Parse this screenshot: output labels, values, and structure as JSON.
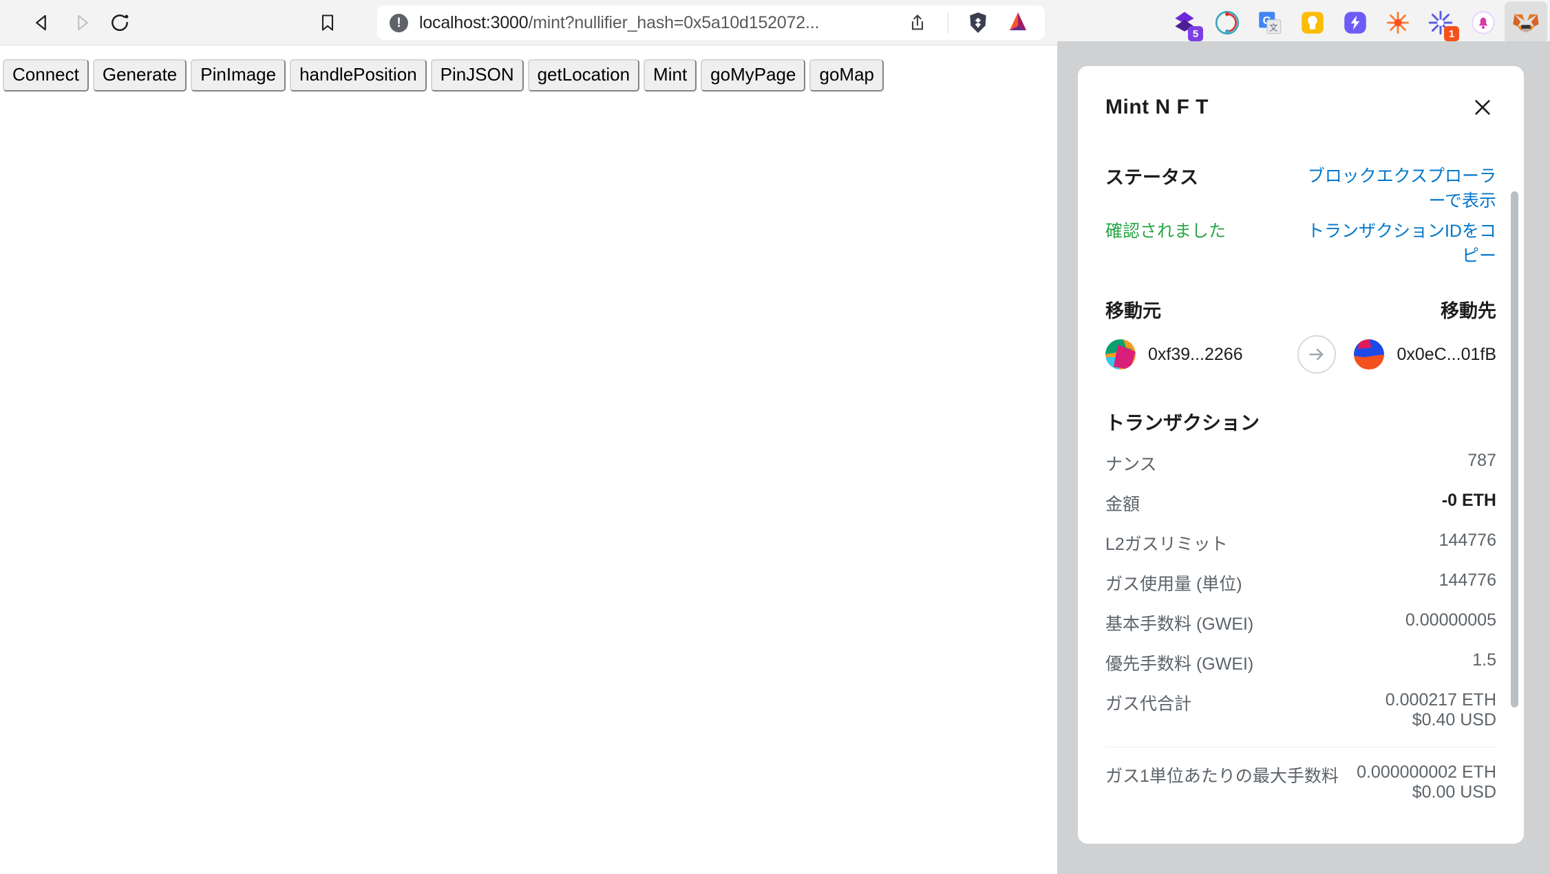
{
  "browser": {
    "back_label": "Back",
    "forward_label": "Forward",
    "reload_label": "Reload",
    "bookmark_label": "Bookmark",
    "url_host": "localhost:3000",
    "url_path": "/mint?nullifier_hash=0x5a10d152072...",
    "url_full": "localhost:3000/mint?nullifier_hash=0x5a10d152072...",
    "security_icon": "not-secure-icon",
    "share_label": "Share",
    "shields_label": "Brave Shields",
    "rewards_label": "Brave Rewards",
    "extensions": [
      {
        "name": "ethereum-wallet-extension",
        "badge": "5",
        "badge_color": "#8247e5"
      },
      {
        "name": "sync-extension",
        "badge": "",
        "badge_color": ""
      },
      {
        "name": "google-translate-extension",
        "badge": "",
        "badge_color": ""
      },
      {
        "name": "notion-web-clipper-extension",
        "badge": "",
        "badge_color": ""
      },
      {
        "name": "lightning-extension",
        "badge": "",
        "badge_color": ""
      },
      {
        "name": "starburst-extension",
        "badge": "",
        "badge_color": ""
      },
      {
        "name": "snowflake-extension",
        "badge": "1",
        "badge_color": "#f6511d"
      },
      {
        "name": "notifications-bell-extension",
        "badge": "",
        "badge_color": ""
      },
      {
        "name": "metamask-extension",
        "badge": "",
        "badge_color": ""
      }
    ]
  },
  "page": {
    "buttons": [
      "Connect",
      "Generate",
      "PinImage",
      "handlePosition",
      "PinJSON",
      "getLocation",
      "Mint",
      "goMyPage",
      "goMap"
    ]
  },
  "metamask": {
    "title": "Mint N F T",
    "close_label": "閉じる",
    "status": {
      "label": "ステータス",
      "value": "確認されました",
      "value_color": "#28a745",
      "view_explorer_link": "ブロックエクスプローラーで表示",
      "copy_txid_link": "トランザクションIDをコピー",
      "link_color": "#0376c9"
    },
    "transfer": {
      "from_label": "移動元",
      "to_label": "移動先",
      "from_address": "0xf39...2266",
      "to_address": "0x0eC...01fB",
      "arrow_icon": "arrow-right-icon"
    },
    "transaction": {
      "heading": "トランザクション",
      "rows": [
        {
          "label": "ナンス",
          "value": "787",
          "sub": "",
          "strong": false
        },
        {
          "label": "金額",
          "value": "-0 ETH",
          "sub": "",
          "strong": true
        },
        {
          "label": "L2ガスリミット",
          "value": "144776",
          "sub": "",
          "strong": false
        },
        {
          "label": "ガス使用量 (単位)",
          "value": "144776",
          "sub": "",
          "strong": false
        },
        {
          "label": "基本手数料 (GWEI)",
          "value": "0.00000005",
          "sub": "",
          "strong": false
        },
        {
          "label": "優先手数料 (GWEI)",
          "value": "1.5",
          "sub": "",
          "strong": false
        },
        {
          "label": "ガス代合計",
          "value": "0.000217 ETH",
          "sub": "$0.40 USD",
          "strong": false
        },
        {
          "label": "ガス1単位あたりの最大手数料",
          "value": "0.000000002 ETH",
          "sub": "$0.00 USD",
          "strong": false
        }
      ]
    }
  }
}
